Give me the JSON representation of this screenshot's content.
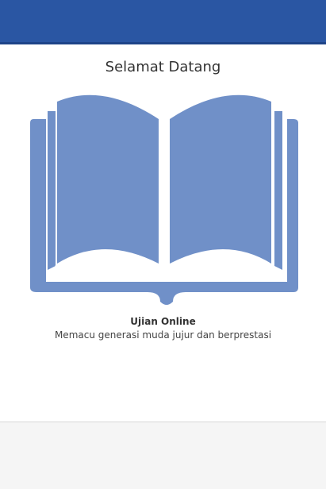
{
  "header": {
    "color": "#2a56a3"
  },
  "welcome": {
    "title": "Selamat Datang"
  },
  "hero": {
    "icon": "open-book-icon",
    "color": "#7090c8"
  },
  "app": {
    "name": "Ujian Online",
    "tagline": "Memacu generasi muda jujur dan berprestasi"
  }
}
